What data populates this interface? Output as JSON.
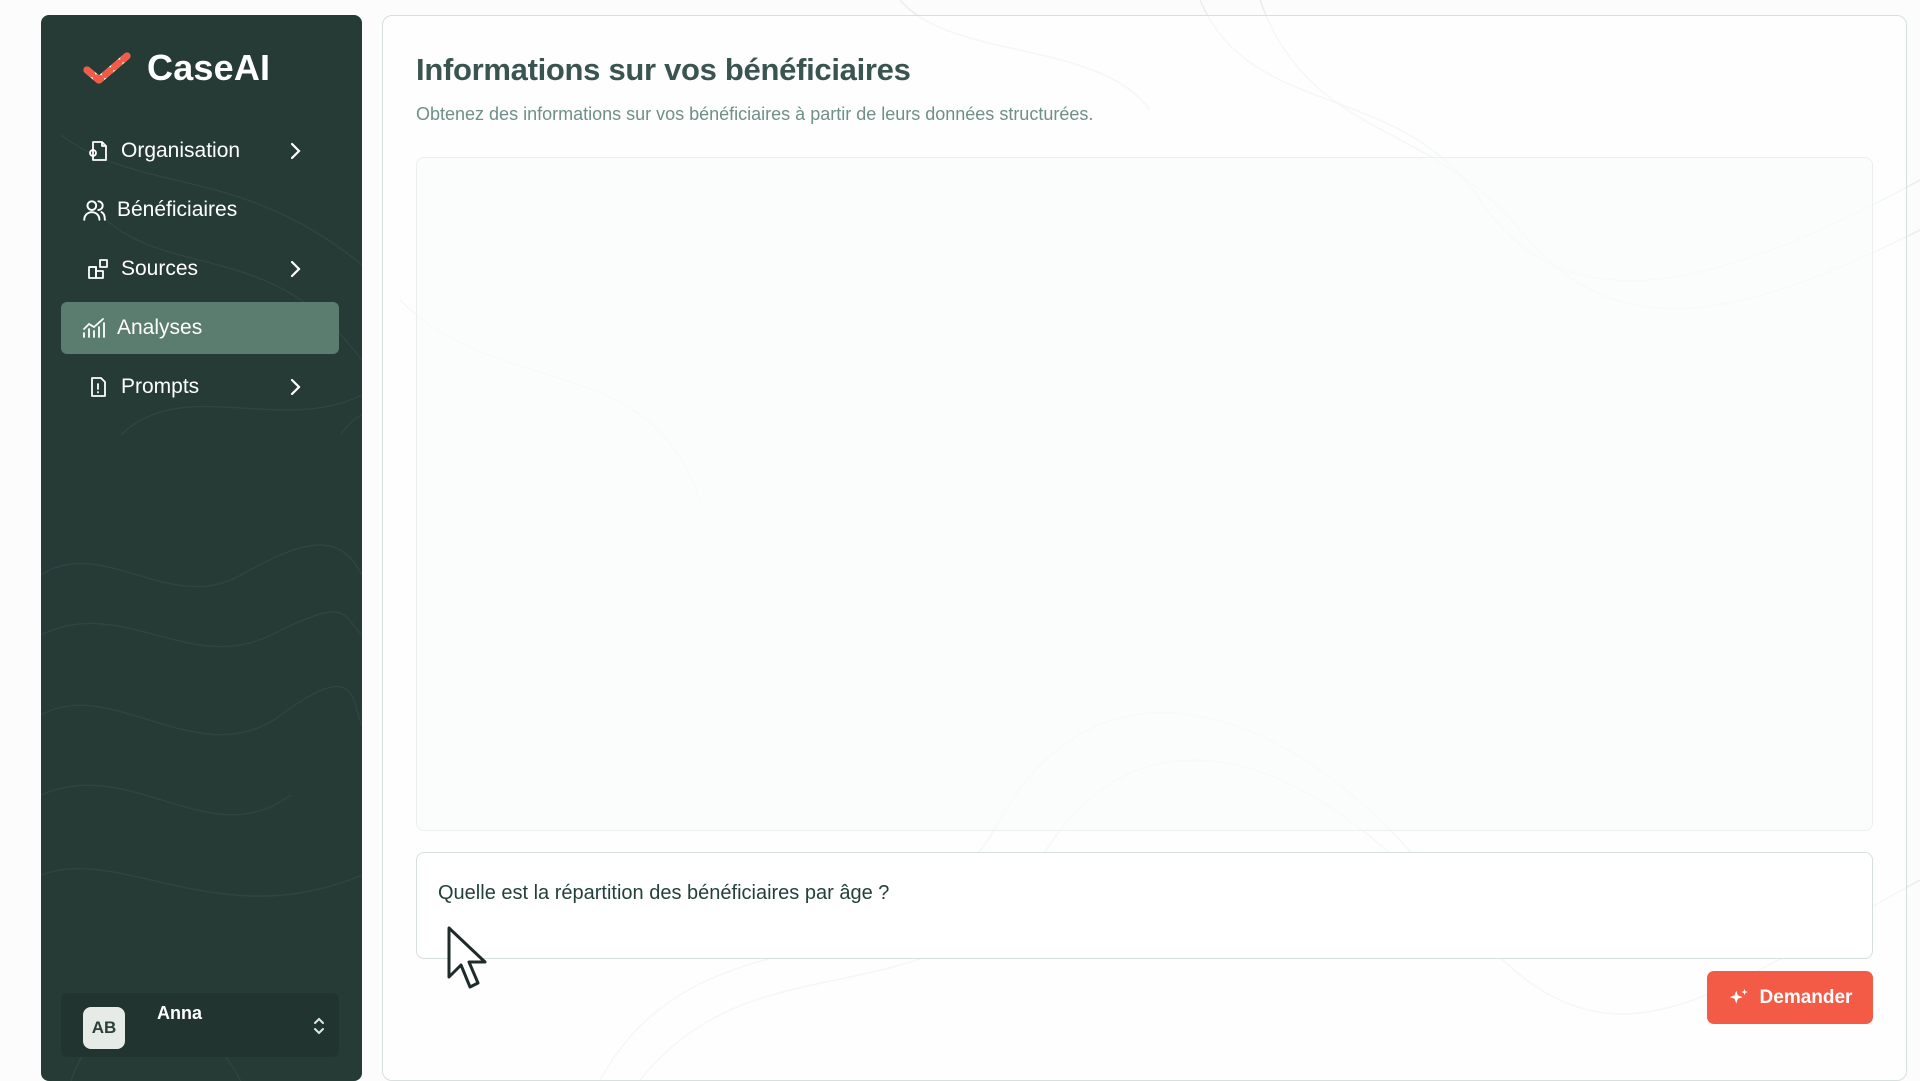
{
  "app": {
    "name": "CaseAI"
  },
  "sidebar": {
    "items": [
      {
        "label": "Organisation",
        "icon": "building-icon",
        "has_chevron": true,
        "active": false
      },
      {
        "label": "Bénéficiaires",
        "icon": "users-icon",
        "has_chevron": false,
        "active": false
      },
      {
        "label": "Sources",
        "icon": "blocks-icon",
        "has_chevron": true,
        "active": false
      },
      {
        "label": "Analyses",
        "icon": "chart-icon",
        "has_chevron": false,
        "active": true
      },
      {
        "label": "Prompts",
        "icon": "file-alert-icon",
        "has_chevron": true,
        "active": false
      }
    ],
    "user": {
      "initials": "AB",
      "name": "Anna"
    }
  },
  "main": {
    "title": "Informations sur vos bénéficiaires",
    "subtitle": "Obtenez des informations sur vos bénéficiaires à partir de leurs données structurées.",
    "question": "Quelle est la répartition des bénéficiaires par âge ?",
    "ask_button": "Demander"
  },
  "colors": {
    "sidebar_bg": "#263a36",
    "active_item": "#5b7d6f",
    "accent": "#f35b46",
    "title": "#3a5550",
    "subtitle": "#6f8f88"
  }
}
